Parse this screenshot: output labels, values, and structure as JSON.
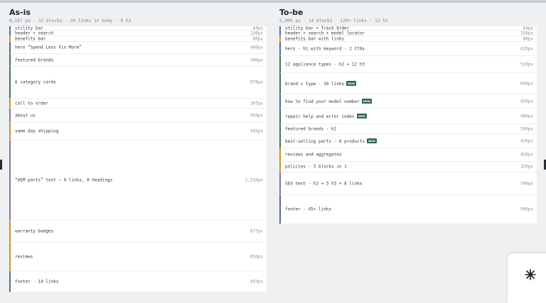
{
  "left": {
    "title": "As-is",
    "subtitle": "8,197 px · 12 blocks · 20 links in body · 0 h2",
    "blocks": [
      {
        "label": "utility bar",
        "px": "44px",
        "color": "blue",
        "new": false
      },
      {
        "label": "header + search",
        "px": "150px",
        "color": "blue",
        "new": false
      },
      {
        "label": "benefits bar",
        "px": "80px",
        "color": "orange",
        "new": false
      },
      {
        "label": "hero “Spend Less Fix More”",
        "px": "400px",
        "color": "blue",
        "new": false
      },
      {
        "label": "featured brands",
        "px": "300px",
        "color": "green",
        "new": false
      },
      {
        "label": "6 category cards",
        "px": "978px",
        "color": "green",
        "new": false
      },
      {
        "label": "call to order",
        "px": "307px",
        "color": "orange",
        "new": false
      },
      {
        "label": "about us",
        "px": "450px",
        "color": "purple",
        "new": false
      },
      {
        "label": "same day shipping",
        "px": "545px",
        "color": "orange",
        "new": false
      },
      {
        "label": "“OEM parts” text — 0 links, 0 headings",
        "px": "2,510px",
        "color": "purple",
        "new": false
      },
      {
        "label": "warranty badges",
        "px": "677px",
        "color": "orange",
        "new": false
      },
      {
        "label": "reviews",
        "px": "856px",
        "color": "orange",
        "new": false
      },
      {
        "label": "footer · 14 links",
        "px": "893px",
        "color": "slate",
        "new": false
      }
    ]
  },
  "right": {
    "title": "To-be",
    "subtitle": "5,900 px · 14 blocks · 120+ links · 12 h2",
    "blocks": [
      {
        "label": "utility bar + Track Order",
        "px": "44px",
        "color": "blue",
        "new": false
      },
      {
        "label": "header + search + model locator",
        "px": "150px",
        "color": "blue",
        "new": false
      },
      {
        "label": "benefits bar with links",
        "px": "80px",
        "color": "orange",
        "new": false
      },
      {
        "label": "hero · h1 with keyword · 2 CTAs",
        "px": "420px",
        "color": "blue",
        "new": false
      },
      {
        "label": "12 appliance types · h2 + 12 h3",
        "px": "520px",
        "color": "green",
        "new": false
      },
      {
        "label": "brand × type · 30 links",
        "px": "640px",
        "color": "green",
        "new": true
      },
      {
        "label": "how to find your model number",
        "px": "420px",
        "color": "blue",
        "new": true
      },
      {
        "label": "repair help and error codes",
        "px": "480px",
        "color": "green",
        "new": true
      },
      {
        "label": "featured brands · h2",
        "px": "300px",
        "color": "green",
        "new": false
      },
      {
        "label": "best-selling parts · 8 products",
        "px": "420px",
        "color": "green",
        "new": true
      },
      {
        "label": "reviews and aggregates",
        "px": "420px",
        "color": "orange",
        "new": false
      },
      {
        "label": "policies · 3 blocks in 1",
        "px": "320px",
        "color": "orange",
        "new": false
      },
      {
        "label": "SEO text · h2 + 3 h3 + 8 links",
        "px": "700px",
        "color": "purple",
        "new": false
      },
      {
        "label": "footer · 45+ links",
        "px": "900px",
        "color": "slate",
        "new": false
      }
    ],
    "new_badge": "NEW"
  },
  "colors": {
    "blue": "#4d6d91",
    "green": "#3a7a55",
    "orange": "#d98a2b",
    "purple": "#8b6fb0",
    "slate": "#5a6c80"
  },
  "icons": {
    "floating_card": "sparkle-icon"
  }
}
